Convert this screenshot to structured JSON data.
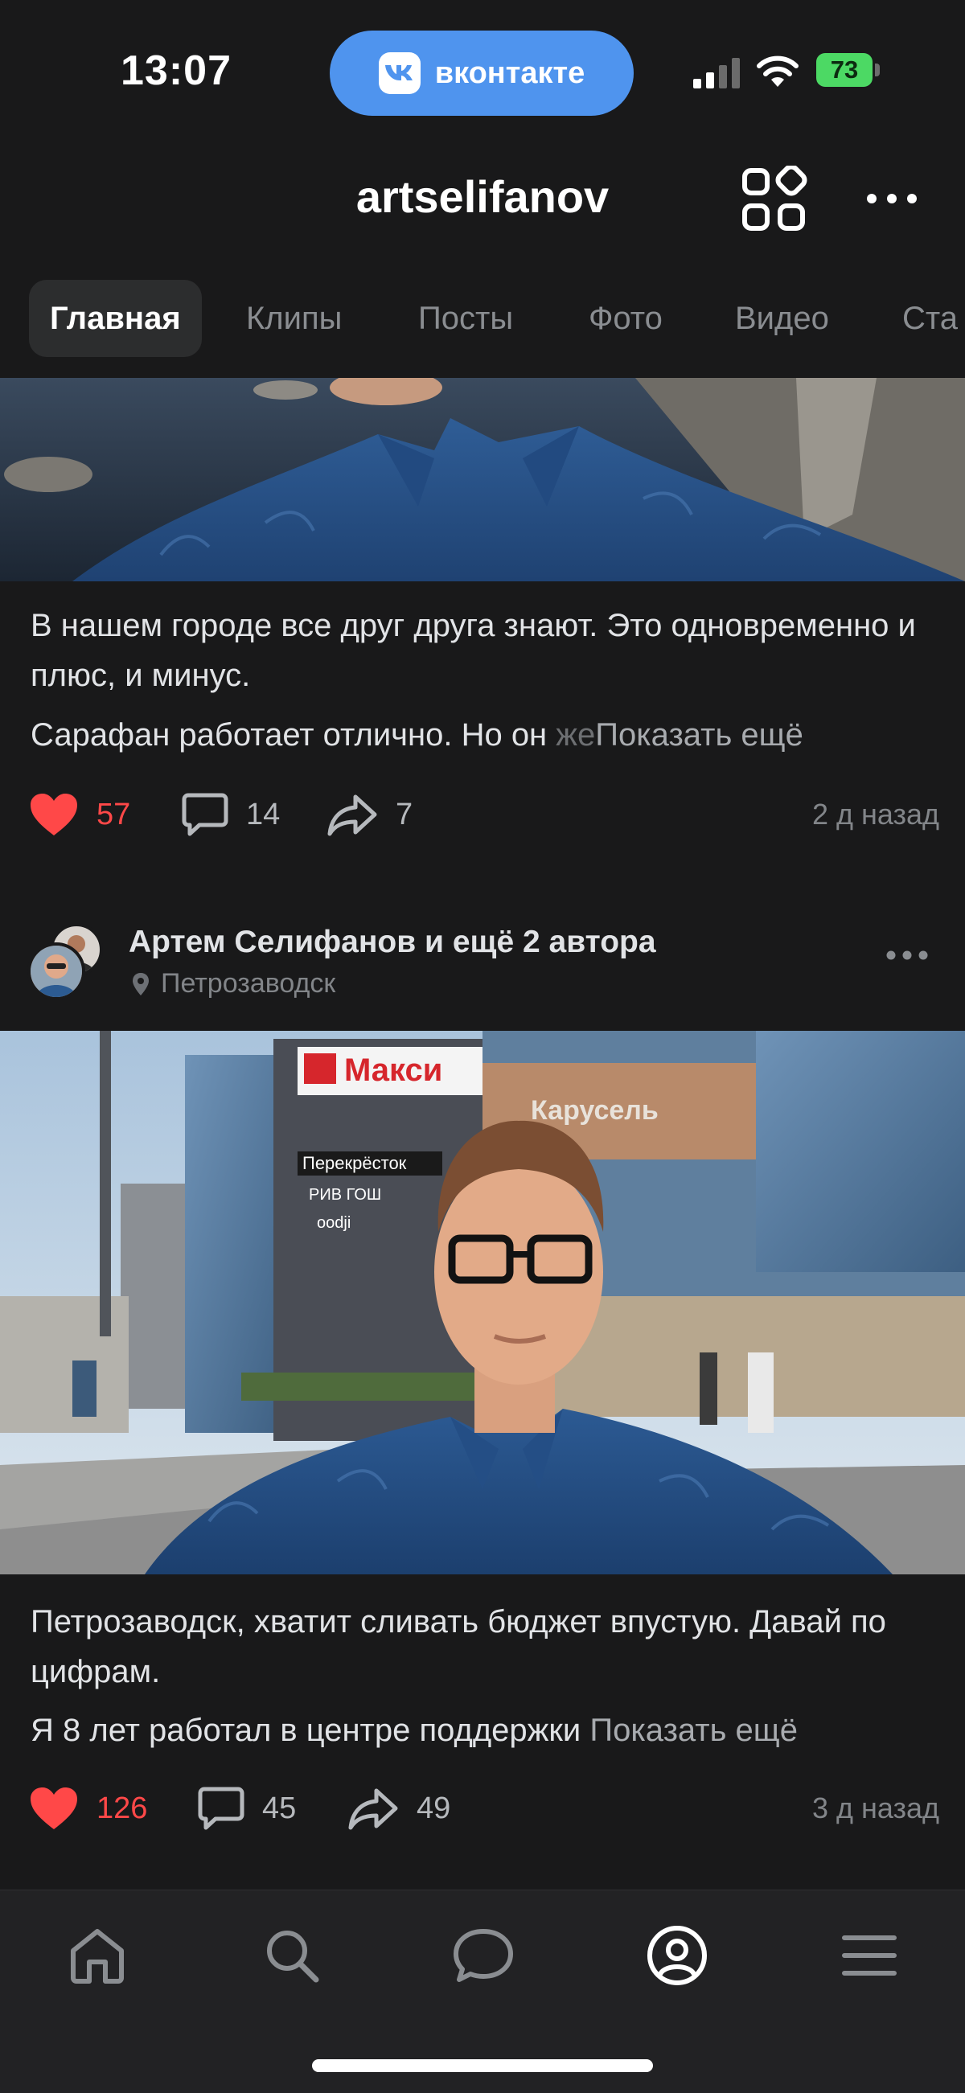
{
  "status_bar": {
    "time": "13:07",
    "app_pill_label": "вконтакте",
    "battery_level": "73",
    "colors": {
      "pill": "#4f94ee",
      "battery": "#4cd964"
    }
  },
  "header": {
    "title": "artselifanov",
    "icons": [
      "apps-grid-icon",
      "more-horizontal-icon"
    ]
  },
  "tabs": [
    {
      "label": "Главная",
      "active": true
    },
    {
      "label": "Клипы",
      "active": false
    },
    {
      "label": "Посты",
      "active": false
    },
    {
      "label": "Фото",
      "active": false
    },
    {
      "label": "Видео",
      "active": false
    },
    {
      "label": "Ста",
      "active": false
    }
  ],
  "post1": {
    "text": "В нашем городе все друг друга знают. Это одновременно и плюс, и минус.",
    "preview_start": "Сарафан работает отлично. Но он ",
    "preview_fade": "же",
    "show_more": "Показать ещё",
    "likes": "57",
    "comments": "14",
    "reposts": "7",
    "time_ago": "2 д назад"
  },
  "post2": {
    "author": "Артем Селифанов и ещё 2 автора",
    "location": "Петрозаводск",
    "photo_signs": [
      "Макси",
      "Перекрёсток",
      "РИВ ГОШ",
      "oodji",
      "Карусель"
    ],
    "text": "Петрозаводск, хватит сливать бюджет впустую. Давай по цифрам.",
    "preview_start": "Я 8 лет работал в центре поддержки ",
    "show_more": "Показать ещё",
    "likes": "126",
    "comments": "45",
    "reposts": "49",
    "time_ago": "3 д назад"
  },
  "bottom_nav": {
    "items": [
      "home-icon",
      "search-icon",
      "messages-icon",
      "profile-icon",
      "menu-icon"
    ],
    "active": "profile-icon"
  },
  "accent_colors": {
    "like": "#ff4848",
    "background": "#19191a"
  }
}
